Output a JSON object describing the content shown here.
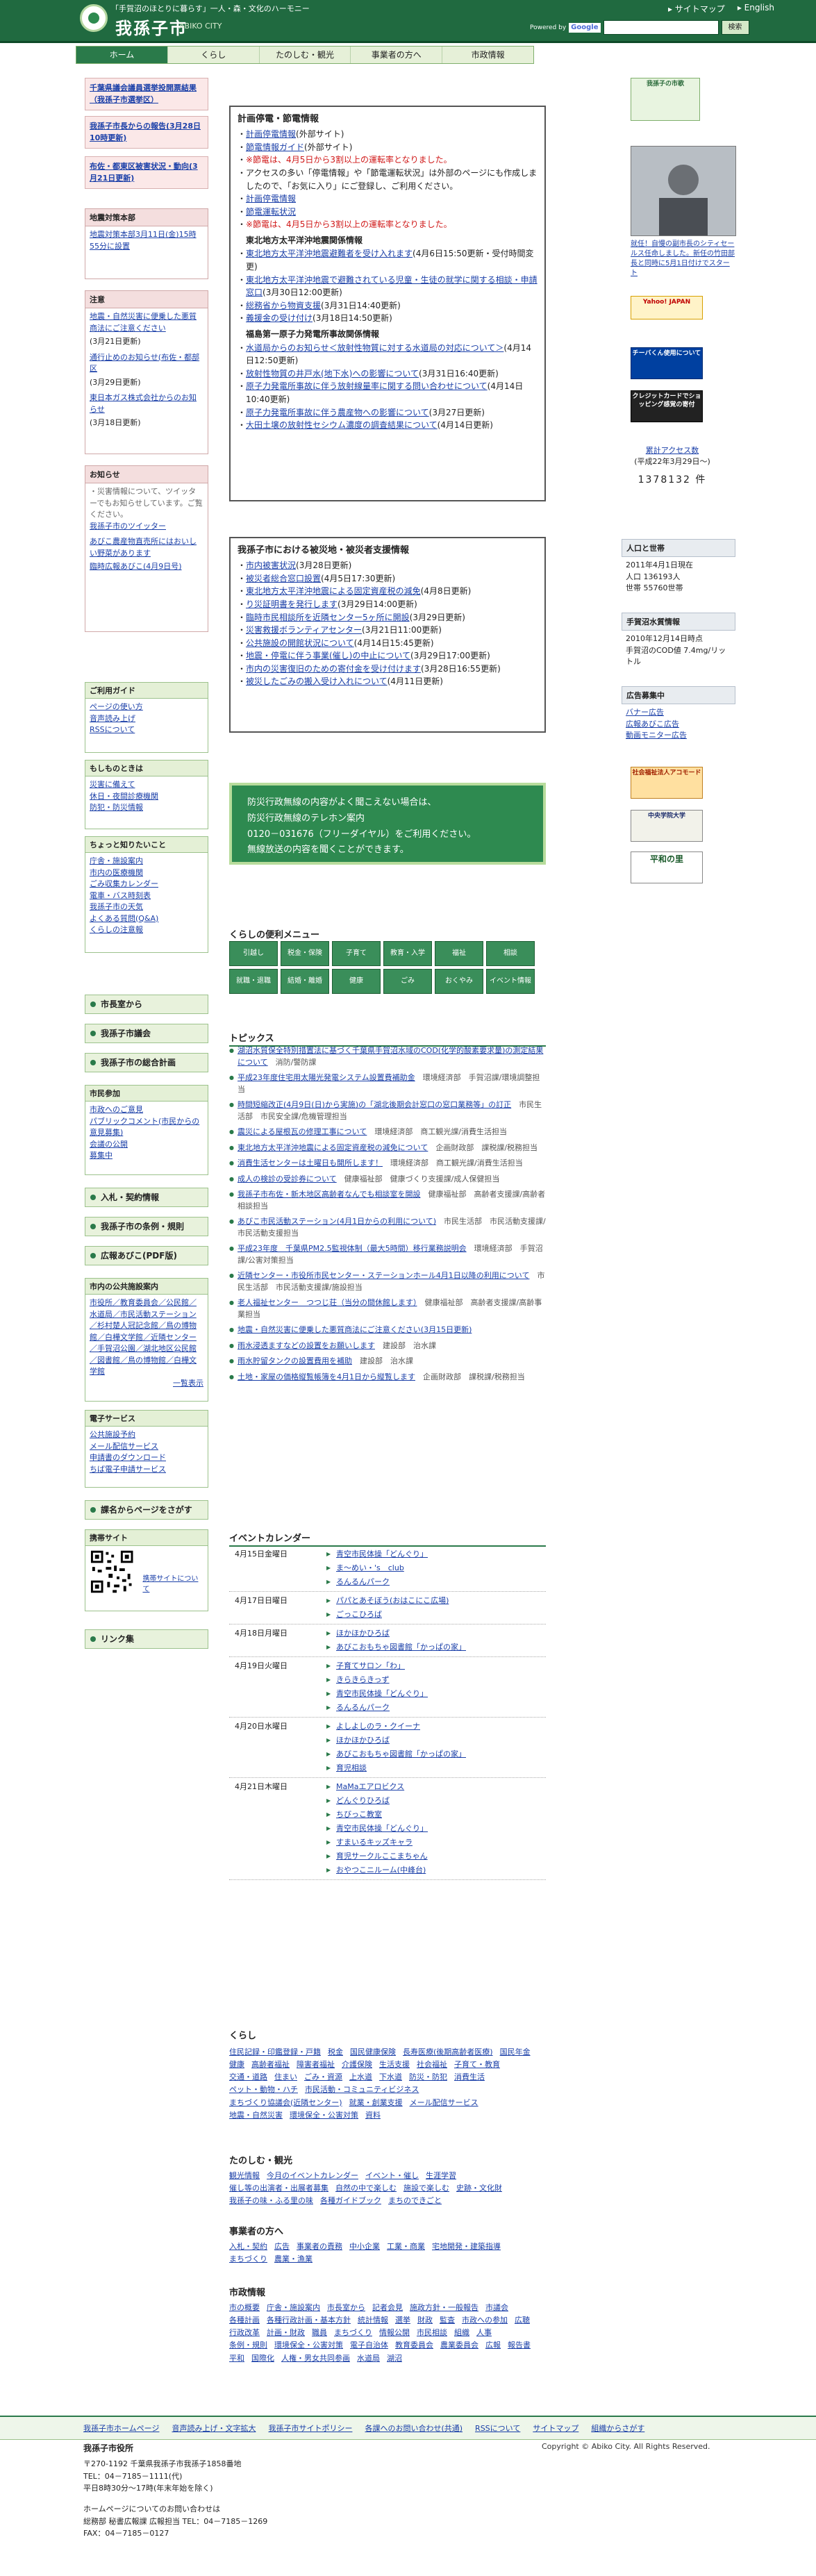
{
  "header": {
    "tagline": "「手賀沼のほとりに暮らす」一人・森・文化のハーモニー",
    "site_name": "我孫子市",
    "site_roman": "ABIKO CITY",
    "sitemap": "サイトマップ",
    "english": "English",
    "powered_by": "Powered by",
    "google": "Google",
    "search_button": "検索",
    "search_placeholder": ""
  },
  "nav": [
    "ホーム",
    "くらし",
    "たのしむ・観光",
    "事業者の方へ",
    "市政情報"
  ],
  "left": {
    "pink_links": [
      "千葉県議会議員選挙投開票結果（我孫子市選挙区）",
      "我孫子市長からの報告(3月28日10時更新)",
      "布佐・都東区被害状況・動向(3月21日更新)"
    ],
    "hq": {
      "title": "地震対策本部",
      "link": "地震対策本部3月11日(金)15時55分に設置"
    },
    "attention": {
      "title": "注意",
      "items": [
        {
          "text": "地震・自然災害に便乗した悪質商法にご注意ください",
          "date": "(3月21日更新)"
        },
        {
          "text": "通行止めのお知らせ(布佐・都部区",
          "date": "(3月29日更新)"
        },
        {
          "text": "東日本ガス株式会社からのお知らせ",
          "date": "(3月18日更新)"
        }
      ]
    },
    "oshirase": {
      "title": "お知らせ",
      "intro": "・災害情報について、ツイッターでもお知らせしています。ご覧ください。",
      "twitter": "我孫子市のツイッター",
      "items": [
        "あびこ農産物直売所にはおいしい野菜があります",
        "臨時広報あびこ(4月9日号)"
      ]
    },
    "guide": {
      "title": "ご利用ガイド",
      "items": [
        "ページの使い方",
        "音声読み上げ",
        "RSSについて"
      ]
    },
    "emergency": {
      "title": "もしものときは",
      "items": [
        "災害に備えて",
        "休日・夜間診療機関",
        "防犯・防災情報"
      ]
    },
    "quick": {
      "title": "ちょっと知りたいこと",
      "items": [
        "庁舎・施設案内",
        "市内の医療機関",
        "ごみ収集カレンダー",
        "電車・バス時刻表",
        "我孫子市の天気",
        "よくある質問(Q&A)",
        "くらしの注意報"
      ]
    },
    "buttons": [
      "市長室から",
      "我孫子市議会",
      "我孫子市の総合計画"
    ],
    "participation": {
      "title": "市民参加",
      "items": [
        "市政へのご意見",
        "パブリックコメント(市民からの意見募集)",
        "会議の公開",
        "募集中"
      ]
    },
    "buttons2": [
      "入札・契約情報",
      "我孫子市の条例・規則",
      "広報あびこ(PDF版)"
    ],
    "facilities": {
      "title": "市内の公共施設案内",
      "text": "市役所／教育委員会／公民館／水道局／市民活動ステーション／杉村楚人冠記念館／鳥の博物館／白樺文学館／近隣センター／手賀沼公園／湖北地区公民館／図書館／鳥の博物館／白樺文学館",
      "more": "一覧表示"
    },
    "e_service": {
      "title": "電子サービス",
      "items": [
        "公共施設予約",
        "メール配信サービス",
        "申請書のダウンロード",
        "ちば電子申請サービス"
      ]
    },
    "buttons3": [
      "課名からページをさがす"
    ],
    "mobile": {
      "title": "携帯サイト",
      "link": "携帯サイトについて"
    },
    "buttons4": [
      "リンク集"
    ]
  },
  "notice1": {
    "title": "計画停電・節電情報",
    "lines": [
      {
        "t": "計画停電情報",
        "s": "(外部サイト)",
        "cls": "lk"
      },
      {
        "t": "節電情報ガイド",
        "s": "(外部サイト)",
        "cls": "lk"
      },
      {
        "t": "※節電は、4月5日から3割以上の運転率となりました。",
        "s": "",
        "cls": "red"
      },
      {
        "t": "アクセスの多い「停電情報」や「節電運転状況」は外部のページにも作成しましたので、「お気に入り」にご登録し、ご利用ください。",
        "s": "",
        "cls": "plain"
      },
      {
        "t": "計画停電情報",
        "s": "",
        "cls": "lk"
      },
      {
        "t": "節電運転状況",
        "s": "",
        "cls": "lk"
      },
      {
        "t": "※節電は、4月5日から3割以上の運転率となりました。",
        "s": "",
        "cls": "red"
      }
    ],
    "sub1": "東北地方太平洋沖地震関係情報",
    "sub1_items": [
      {
        "t": "東北地方太平洋沖地震避難者を受け入れます",
        "s": "(4月6日15:50更新・受付時間変更)"
      },
      {
        "t": "東北地方太平洋沖地震で避難されている児童・生徒の就学に関する相談・申請窓口",
        "s": "(3月30日12:00更新)"
      },
      {
        "t": "総務省から物資支援",
        "s": "(3月31日14:40更新)"
      },
      {
        "t": "義援金の受け付け",
        "s": "(3月18日14:50更新)"
      }
    ],
    "sub2": "福島第一原子力発電所事故関係情報",
    "sub2_items": [
      {
        "t": "水道局からのお知らせ＜放射性物質に対する水道局の対応について＞",
        "s": "(4月14日12:50更新)"
      },
      {
        "t": "放射性物質の井戸水(地下水)への影響について",
        "s": "(3月31日16:40更新)"
      },
      {
        "t": "原子力発電所事故に伴う放射線量率に関する問い合わせについて",
        "s": "(4月14日10:40更新)"
      },
      {
        "t": "原子力発電所事故に伴う農産物への影響について",
        "s": "(3月27日更新)"
      },
      {
        "t": "大田土壌の放射性セシウム濃度の調査結果について",
        "s": "(4月14日更新)"
      }
    ]
  },
  "notice2": {
    "title": "我孫子市における被災地・被災者支援情報",
    "items": [
      {
        "t": "市内被害状況",
        "s": "(3月28日更新)"
      },
      {
        "t": "被災者総合窓口設置",
        "s": "(4月5日17:30更新)"
      },
      {
        "t": "東北地方太平洋沖地震による固定資産税の減免",
        "s": "(4月8日更新)"
      },
      {
        "t": "り災証明書を発行します",
        "s": "(3月29日14:00更新)"
      },
      {
        "t": "臨時市民相談所を近隣センター5ヶ所に開設",
        "s": "(3月29日更新)"
      },
      {
        "t": "災害救援ボランティアセンター",
        "s": "(3月21日11:00更新)"
      },
      {
        "t": "公共施設の開館状況について",
        "s": "(4月14日15:45更新)"
      },
      {
        "t": "地震・停電に伴う事業(催し)の中止について",
        "s": "(3月29日17:00更新)"
      },
      {
        "t": "市内の災害復旧のための寄付金を受け付けます",
        "s": "(3月28日16:55更新)"
      },
      {
        "t": "被災したごみの搬入受け入れについて",
        "s": "(4月11日更新)"
      }
    ]
  },
  "bousai": {
    "l1": "防災行政無線の内容がよく聞こえない場合は、",
    "l2": "防災行政無線のテレホン案内",
    "l3": "0120－031676（フリーダイヤル）をご利用ください。",
    "l4": "無線放送の内容を聞くことができます。"
  },
  "kurashi": {
    "title": "くらしの便利メニュー",
    "items": [
      "引越し",
      "税金・保険",
      "子育て",
      "教育・入学",
      "福祉",
      "相談",
      "就職・退職",
      "結婚・離婚",
      "健康",
      "ごみ",
      "おくやみ",
      "イベント情報"
    ]
  },
  "topics": {
    "title": "トピックス",
    "items": [
      {
        "t": "湖沼水質保全特別措置法に基づく千葉県手賀沼水域のCOD(化学的酸素要求量)の測定結果について",
        "d": "消防/警防課"
      },
      {
        "t": "平成23年度住宅用太陽光発電システム設置費補助金",
        "d": "環境経済部　手賀沼課/環境調整担当"
      },
      {
        "t": "時間短縮改正(4月9日(日)から実施)の「湖北後期会計窓口の窓口業務等」の訂正",
        "d": "市民生活部　市民安全課/危機管理担当"
      },
      {
        "t": "震災による屋根瓦の修理工事について",
        "d": "環境経済部　商工観光課/消費生活担当"
      },
      {
        "t": "東北地方太平洋沖地震による固定資産税の減免について",
        "d": "企画財政部　課税課/税務担当"
      },
      {
        "t": "消費生活センターは土曜日も開所します！",
        "d": "環境経済部　商工観光課/消費生活担当"
      },
      {
        "t": "成人の検診の受診券について",
        "d": "健康福祉部　健康づくり支援課/成人保健担当"
      },
      {
        "t": "我孫子市布佐・新木地区高齢者なんでも相談室を開設",
        "d": "健康福祉部　高齢者支援課/高齢者相談担当"
      },
      {
        "t": "あびこ市民活動ステーション(4月1日からの利用について)",
        "d": "市民生活部　市民活動支援課/市民活動支援担当"
      },
      {
        "t": "平成23年度　千葉県PM2.5監視体制（最大5時間）移行業務説明会",
        "d": "環境経済部　手賀沼課/公害対策担当"
      },
      {
        "t": "近隣センター・市役所市民センター・ステーションホール4月1日以降の利用について",
        "d": "市民生活部　市民活動支援課/施設担当"
      },
      {
        "t": "老人福祉センター　つつじ荘（当分の間休館します）",
        "d": "健康福祉部　高齢者支援課/高齢事業担当"
      },
      {
        "t": "地震・自然災害に便乗した悪質商法にご注意ください(3月15日更新)",
        "d": ""
      },
      {
        "t": "雨水浸透ますなどの設置をお願いします",
        "d": "建設部　治水課"
      },
      {
        "t": "雨水貯留タンクの設置費用を補助",
        "d": "建設部　治水課"
      },
      {
        "t": "土地・家屋の価格縦覧帳簿を4月1日から縦覧します",
        "d": "企画財政部　課税課/税務担当"
      }
    ]
  },
  "events": {
    "title": "イベントカレンダー",
    "days": [
      {
        "d": "4月15日金曜日",
        "items": [
          "青空市民体操「どんぐり」",
          "ま～めい・'s　club",
          "るんるんパーク"
        ]
      },
      {
        "d": "4月17日日曜日",
        "items": [
          "パパとあそぼう(おはこにこ広場)",
          "ごっこひろば"
        ]
      },
      {
        "d": "4月18日月曜日",
        "items": [
          "ほかほかひろば",
          "あびこおもちゃ図書館「かっぱの家」"
        ]
      },
      {
        "d": "4月19日火曜日",
        "items": [
          "子育てサロン「わ」",
          "きらきらきっず",
          "青空市民体操「どんぐり」",
          "るんるんパーク"
        ]
      },
      {
        "d": "4月20日水曜日",
        "items": [
          "よしよしのラ・クイーナ",
          "ほかほかひろば",
          "あびこおもちゃ図書館「かっぱの家」",
          "育児相談"
        ]
      },
      {
        "d": "4月21日木曜日",
        "items": [
          "MaMaエアロビクス",
          "どんぐりひろば",
          "ちびっこ教室",
          "青空市民体操「どんぐり」",
          "すまいるキッズキャラ",
          "育児サークルここまちゃん",
          "おやつこニルーム(中峰台)"
        ]
      }
    ]
  },
  "kurashi_links": {
    "title": "くらし",
    "items": [
      "住民記録・印鑑登録・戸籍",
      "税金",
      "国民健康保険",
      "長寿医療(後期高齢者医療)",
      "国民年金",
      "健康",
      "高齢者福祉",
      "障害者福祉",
      "介護保険",
      "生活支援",
      "社会福祉",
      "子育て・教育",
      "交通・道路",
      "住まい",
      "ごみ・資源",
      "上水道",
      "下水道",
      "防災・防犯",
      "消費生活",
      "ペット・動物・ハチ",
      "市民活動・コミュニティビジネス",
      "まちづくり協議会(近隣センター)",
      "就業・創業支援",
      "メール配信サービス",
      "地震・自然災害",
      "環境保全・公害対策",
      "資料"
    ]
  },
  "tanoshimu_links": {
    "title": "たのしむ・観光",
    "items": [
      "観光情報",
      "今月のイベントカレンダー",
      "イベント・催し",
      "生涯学習",
      "催し等の出演者・出展者募集",
      "自然の中で楽しむ",
      "施設で楽しむ",
      "史跡・文化財",
      "我孫子の味・ふる里の味",
      "各種ガイドブック",
      "まちのできごと"
    ]
  },
  "jigyo_links": {
    "title": "事業者の方へ",
    "items": [
      "入札・契約",
      "広告",
      "事業者の責務",
      "中小企業",
      "工業・商業",
      "宅地開発・建築指導",
      "まちづくり",
      "農業・漁業"
    ]
  },
  "shisei_links": {
    "title": "市政情報",
    "items": [
      "市の概要",
      "庁舎・施設案内",
      "市長室から",
      "記者会見",
      "施政方針・一般報告",
      "市議会",
      "各種計画",
      "各種行政計画・基本方針",
      "統計情報",
      "選挙",
      "財政",
      "監査",
      "市政への参加",
      "広聴",
      "行政改革",
      "計画・財政",
      "職員",
      "まちづくり",
      "情報公開",
      "市民相談",
      "組織",
      "人事",
      "条例・規則",
      "環境保全・公害対策",
      "電子自治体",
      "教育委員会",
      "農業委員会",
      "広報",
      "報告書",
      "平和",
      "国際化",
      "人権・男女共同参画",
      "水道局",
      "湖沼"
    ]
  },
  "right": {
    "badge": "我孫子の市歌",
    "photo_caption": "就任！自慢の副市長のシティセールス任命しました。新任の竹田部長と同時に5月1日付けでスタート",
    "banners": [
      "Yahoo! JAPANに我孫子市が出ました",
      "チーバくん使用について",
      "クレジットカードで納税",
      "アクセス数",
      "社会福祉法人アコモード",
      "中央学院大学",
      "平和の里"
    ],
    "yahoo": "Yahoo! JAPAN",
    "chiba": "チーバくん使用について",
    "credit": "クレジットカードでショッピング感覚の寄付",
    "count_label": "累計アクセス数",
    "count_sub": "(平成22年3月29日～)",
    "count": "1378132",
    "count_unit": "件",
    "pop": {
      "title": "人口と世帯",
      "date": "2011年4月1日現在",
      "pop": "人口 136193人",
      "households": "世帯 55760世帯"
    },
    "water": {
      "title": "手賀沼水質情報",
      "date": "2010年12月14日時点",
      "text": "手賀沼のCOD値 7.4mg/リットル"
    },
    "ads": {
      "title": "広告募集中",
      "items": [
        "バナー広告",
        "広報あびこ広告",
        "動画モニター広告"
      ]
    }
  },
  "footer": {
    "nav": [
      "我孫子市ホームページ",
      "音声読み上げ・文字拡大",
      "我孫子市サイトポリシー",
      "各課へのお問い合わせ(共通)",
      "RSSについて",
      "サイトマップ",
      "組織からさがす"
    ],
    "office": "我孫子市役所",
    "address": "〒270-1192 千葉県我孫子市我孫子1858番地",
    "tel": "TEL：04－7185－1111(代)",
    "hours": "平日8時30分～17時(年末年始を除く)",
    "contact1": "ホームページについてのお問い合わせは",
    "contact2": "総務部 秘書広報課 広報担当 TEL：04－7185－1269",
    "contact3": "FAX：04－7185－0127",
    "copyright": "Copyright © Abiko City. All Rights Reserved."
  }
}
